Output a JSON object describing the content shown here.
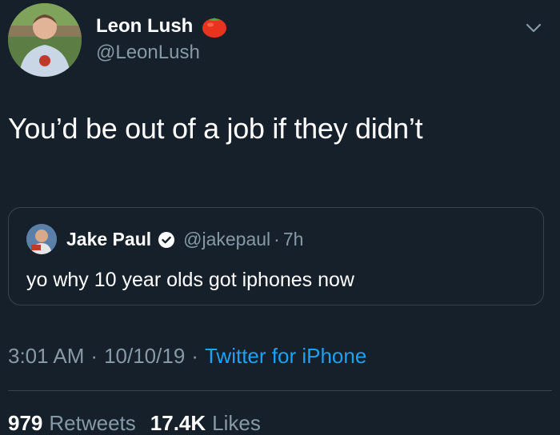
{
  "author": {
    "display_name": "Leon Lush",
    "handle": "@LeonLush",
    "badge_icon": "tomato-icon",
    "avatar_icon": "profile-photo"
  },
  "tweet": {
    "text": "You’d be out of a job if they didn’t"
  },
  "quoted_tweet": {
    "display_name": "Jake Paul",
    "verified_icon": "verified-badge-icon",
    "handle": "@jakepaul",
    "separator": "·",
    "time": "7h",
    "text": "yo why 10 year olds got iphones now"
  },
  "meta": {
    "time": "3:01 AM",
    "separator": "·",
    "date": "10/10/19",
    "source": "Twitter for iPhone"
  },
  "stats": {
    "retweets_count": "979",
    "retweets_label": "Retweets",
    "likes_count": "17.4K",
    "likes_label": "Likes"
  },
  "colors": {
    "background": "#15202b",
    "text_primary": "#ffffff",
    "text_secondary": "#8899a6",
    "link": "#1da1f2",
    "border": "#38444d"
  }
}
